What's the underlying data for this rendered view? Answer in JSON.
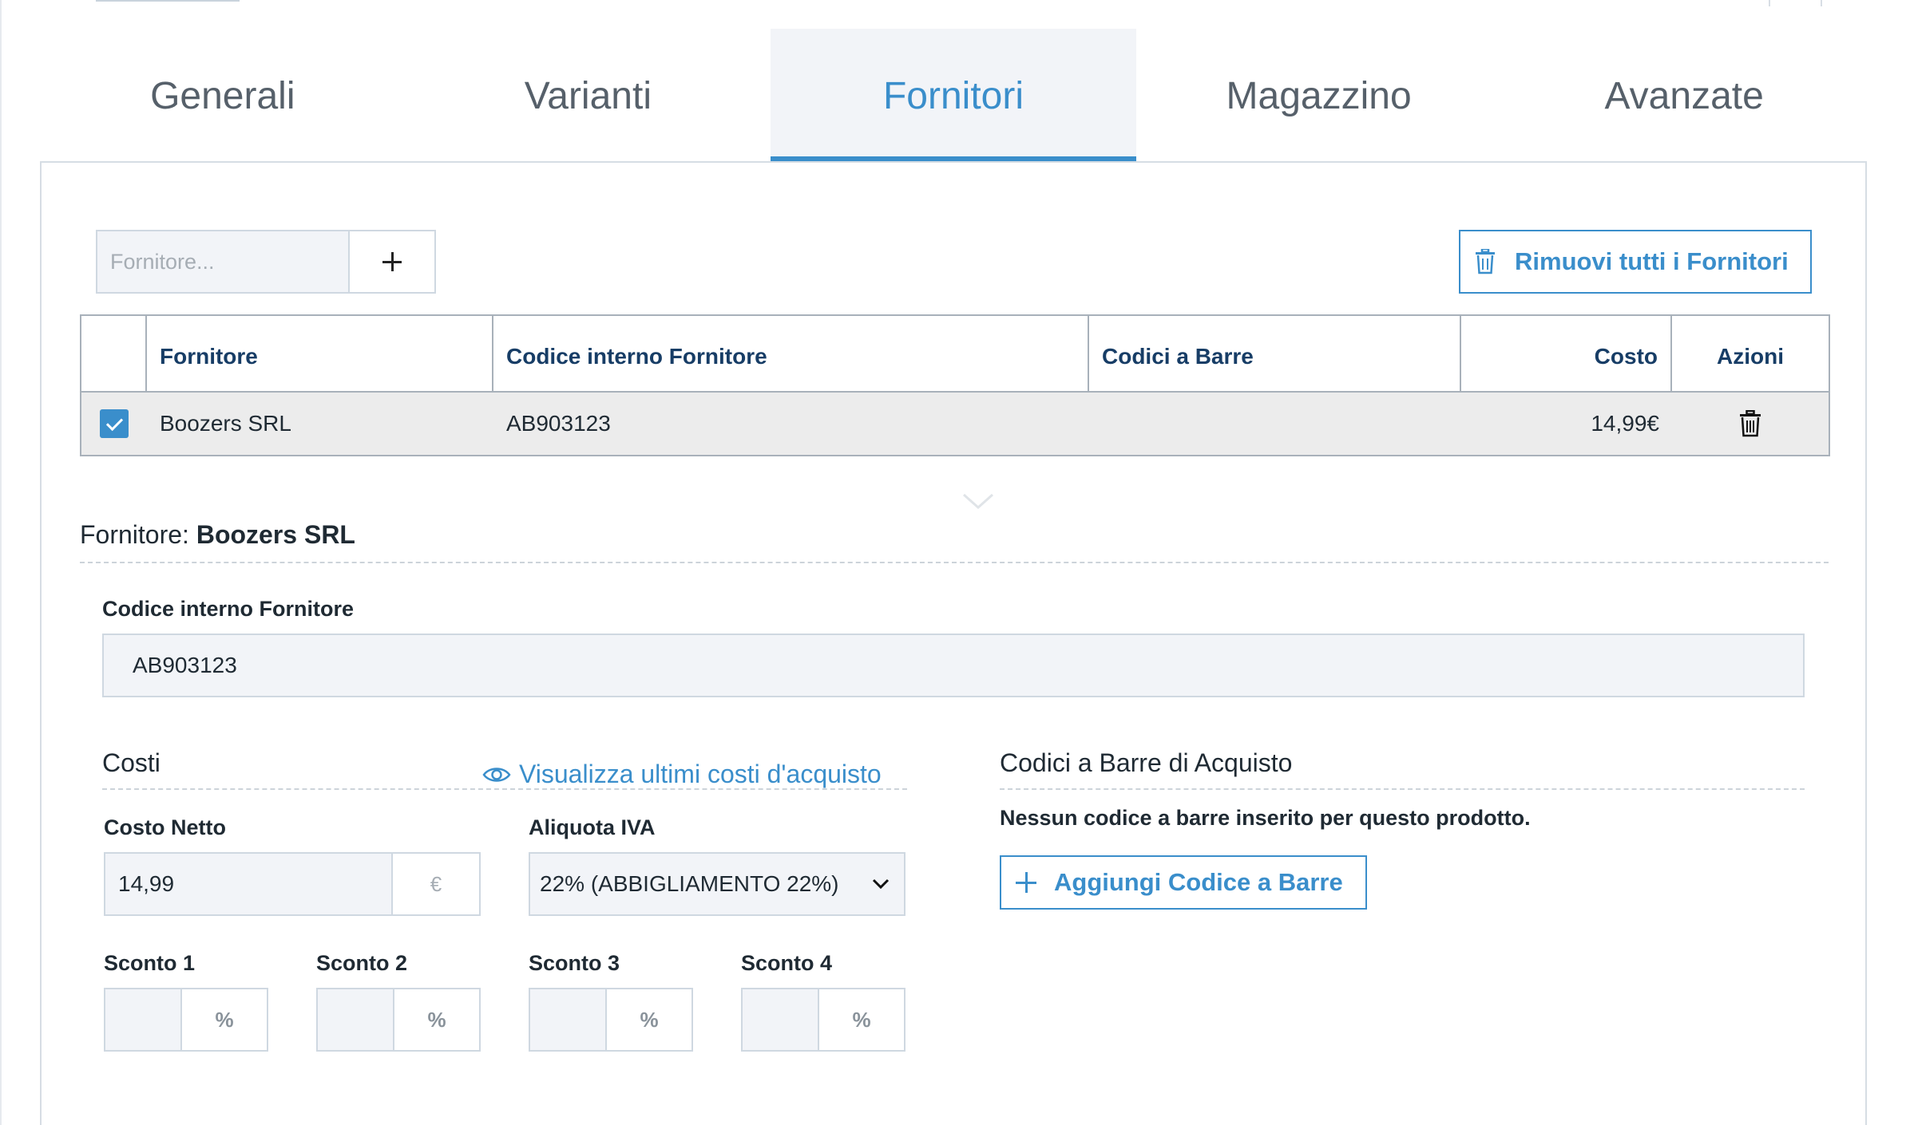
{
  "tabs": [
    {
      "label": "Generali"
    },
    {
      "label": "Varianti"
    },
    {
      "label": "Fornitori"
    },
    {
      "label": "Magazzino"
    },
    {
      "label": "Avanzate"
    }
  ],
  "active_tab": "Fornitori",
  "supplier_search": {
    "placeholder": "Fornitore...",
    "add_icon": "plus-icon"
  },
  "remove_all": {
    "label": "Rimuovi tutti i Fornitori",
    "icon": "trash-icon"
  },
  "table": {
    "headers": [
      "Fornitore",
      "Codice interno Fornitore",
      "Codici a Barre",
      "Costo",
      "Azioni"
    ],
    "rows": [
      {
        "checked": true,
        "fornitore": "Boozers SRL",
        "codice": "AB903123",
        "codici_barre": "",
        "costo": "14,99€",
        "action_icon": "trash-icon"
      }
    ]
  },
  "detail": {
    "title_prefix": "Fornitore:",
    "title_name": "Boozers SRL",
    "codice_label": "Codice interno Fornitore",
    "codice_value": "AB903123"
  },
  "costi": {
    "title": "Costi",
    "view_link": "Visualizza ultimi costi d'acquisto",
    "costo_netto_label": "Costo Netto",
    "costo_netto_value": "14,99",
    "currency": "€",
    "iva_label": "Aliquota IVA",
    "iva_value": "22% (ABBIGLIAMENTO 22%)",
    "sconti": [
      {
        "label": "Sconto 1",
        "value": "",
        "unit": "%"
      },
      {
        "label": "Sconto 2",
        "value": "",
        "unit": "%"
      },
      {
        "label": "Sconto 3",
        "value": "",
        "unit": "%"
      },
      {
        "label": "Sconto 4",
        "value": "",
        "unit": "%"
      }
    ]
  },
  "barcodes": {
    "title": "Codici a Barre di Acquisto",
    "empty_message": "Nessun codice a barre inserito per questo prodotto.",
    "add_label": "Aggiungi Codice a Barre"
  },
  "colors": {
    "accent": "#3a8ecb",
    "header_text": "#173d66",
    "field_bg": "#f2f4f8"
  }
}
